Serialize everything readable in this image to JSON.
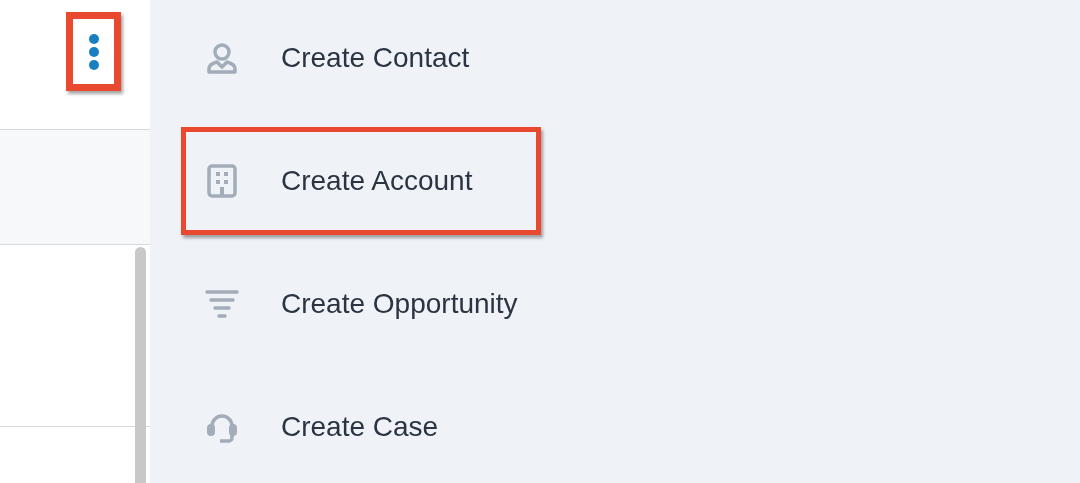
{
  "more_button": {
    "highlighted": true
  },
  "menu": [
    {
      "label": "Create Contact",
      "highlighted": false
    },
    {
      "label": "Create Account",
      "highlighted": true
    },
    {
      "label": "Create Opportunity",
      "highlighted": false
    },
    {
      "label": "Create Case",
      "highlighted": false
    }
  ]
}
